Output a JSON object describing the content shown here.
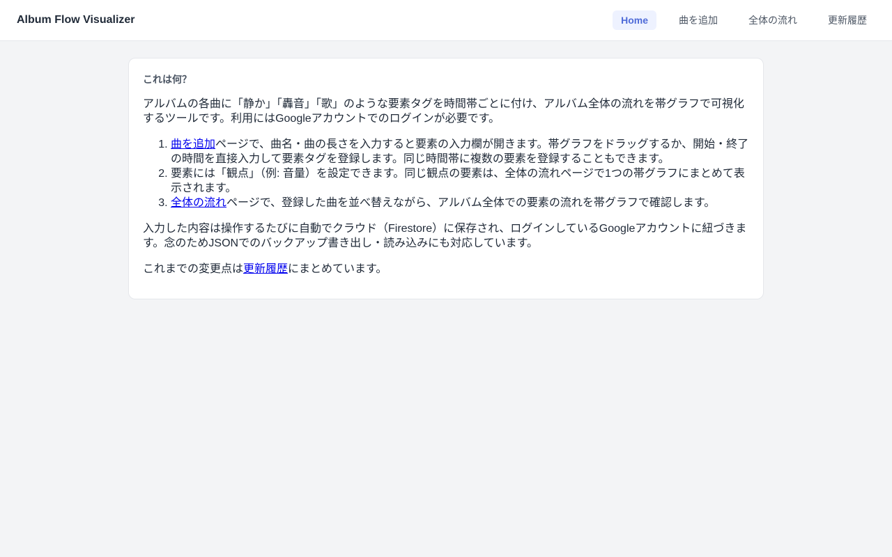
{
  "header": {
    "title": "Album Flow Visualizer",
    "nav": [
      {
        "label": "Home",
        "active": true
      },
      {
        "label": "曲を追加",
        "active": false
      },
      {
        "label": "全体の流れ",
        "active": false
      },
      {
        "label": "更新履歴",
        "active": false
      }
    ]
  },
  "card": {
    "title": "これは何？",
    "intro": "アルバムの各曲に「静か」「轟音」「歌」のような要素タグを時間帯ごとに付け、アルバム全体の流れを帯グラフで可視化するツールです。利用にはGoogleアカウントでのログインが必要です。",
    "steps": [
      {
        "link": "曲を追加",
        "text": "ページで、曲名・曲の長さを入力すると要素の入力欄が開きます。帯グラフをドラッグするか、開始・終了の時間を直接入力して要素タグを登録します。同じ時間帯に複数の要素を登録することもできます。"
      },
      {
        "link": "",
        "text": "要素には「観点」（例: 音量）を設定できます。同じ観点の要素は、全体の流れページで1つの帯グラフにまとめて表示されます。"
      },
      {
        "link": "全体の流れ",
        "text": "ページで、登録した曲を並べ替えながら、アルバム全体での要素の流れを帯グラフで確認します。"
      }
    ],
    "storage": "入力した内容は操作するたびに自動でクラウド（Firestore）に保存され、ログインしているGoogleアカウントに紐づきます。念のためJSONでのバックアップ書き出し・読み込みにも対応しています。",
    "history_prefix": "これまでの変更点は",
    "history_link": "更新履歴",
    "history_suffix": "にまとめています。"
  }
}
